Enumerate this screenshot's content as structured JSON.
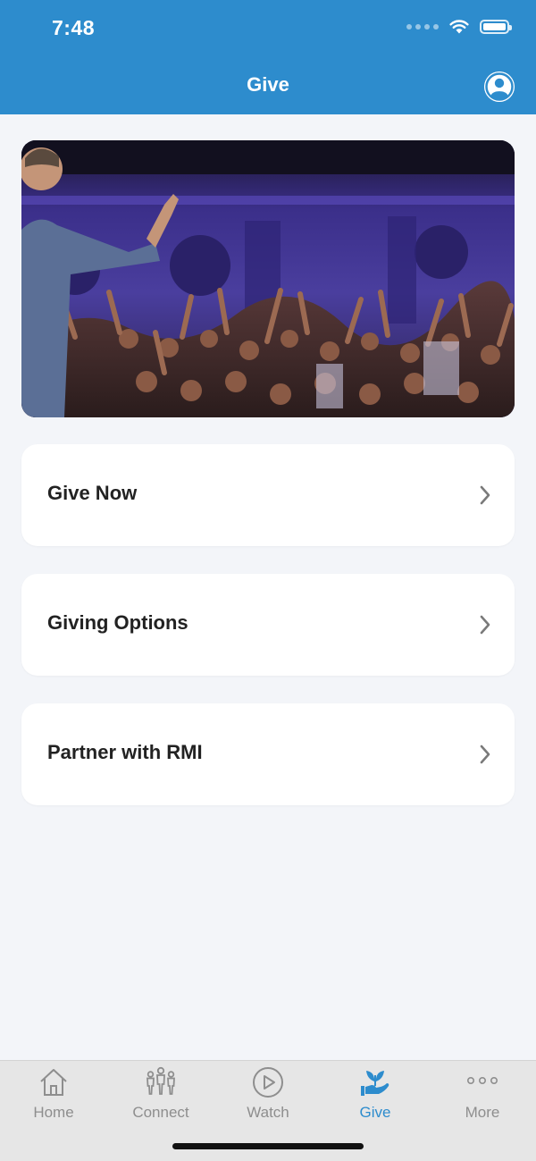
{
  "status_bar": {
    "time": "7:48"
  },
  "header": {
    "title": "Give",
    "profile_icon": "user-avatar-icon"
  },
  "hero": {
    "image": "worship-crowd-raised-hands"
  },
  "menu": {
    "items": [
      {
        "label": "Give Now",
        "icon": "chevron-right-icon"
      },
      {
        "label": "Giving Options",
        "icon": "chevron-right-icon"
      },
      {
        "label": "Partner with RMI",
        "icon": "chevron-right-icon"
      }
    ]
  },
  "tabbar": {
    "active": "Give",
    "tabs": [
      {
        "label": "Home",
        "icon": "home-icon"
      },
      {
        "label": "Connect",
        "icon": "people-icon"
      },
      {
        "label": "Watch",
        "icon": "play-circle-icon"
      },
      {
        "label": "Give",
        "icon": "hand-plant-icon"
      },
      {
        "label": "More",
        "icon": "more-dots-icon"
      }
    ]
  },
  "colors": {
    "accent": "#2d8ccd",
    "background": "#f3f5f9",
    "tab_inactive": "#8e8e8e"
  }
}
